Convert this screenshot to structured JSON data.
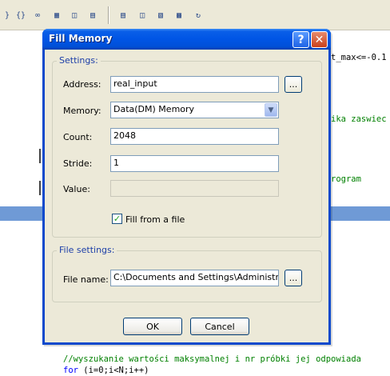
{
  "background": {
    "code_lines": [
      {
        "text": "t_max<=-0.1",
        "color": "black"
      },
      {
        "text": "ika zaswiec",
        "color": "green"
      },
      {
        "text": "rogram",
        "color": "green"
      },
      {
        "text": "//wyszukanie wartości maksymalnej i nr próbki jej odpowiada",
        "color": "green"
      },
      {
        "text": "for (i=0;i<N;i++)",
        "color": "mixed"
      }
    ],
    "for_keyword": "for",
    "for_rest": " (i=0;i<N;i++)"
  },
  "dialog": {
    "title": "Fill Memory",
    "help_label": "?",
    "close_label": "✕",
    "settings_group": "Settings:",
    "address_label": "Address:",
    "address_value": "real_input",
    "browse_label": "...",
    "memory_label": "Memory:",
    "memory_value": "Data(DM) Memory",
    "count_label": "Count:",
    "count_value": "2048",
    "stride_label": "Stride:",
    "stride_value": "1",
    "value_label": "Value:",
    "value_value": "",
    "fill_from_file_label": "Fill from a file",
    "fill_from_file_checked": true,
    "file_settings_group": "File settings:",
    "file_name_label": "File name:",
    "file_name_value": "C:\\Documents and Settings\\Administrator\\",
    "ok_label": "OK",
    "cancel_label": "Cancel"
  }
}
